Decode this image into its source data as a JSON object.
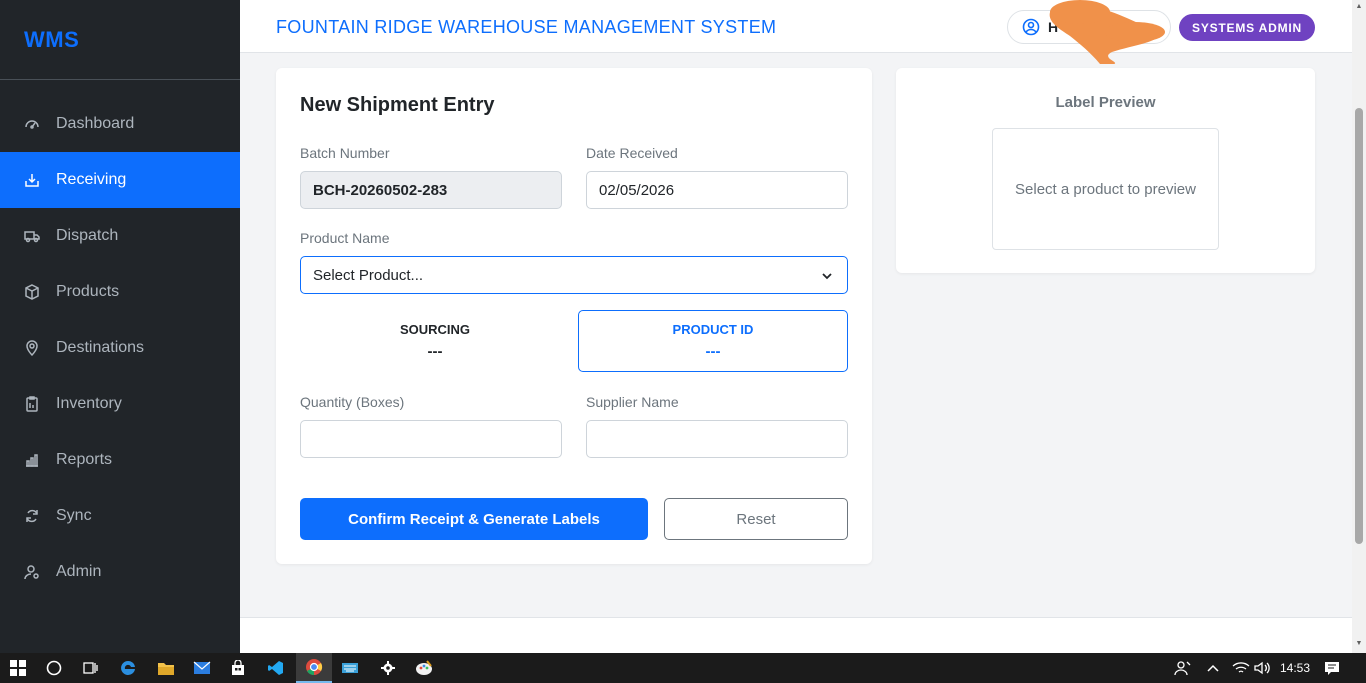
{
  "sidebar": {
    "brand": "WMS",
    "items": [
      {
        "label": "Dashboard",
        "icon": "gauge-icon"
      },
      {
        "label": "Receiving",
        "icon": "inbox-download-icon"
      },
      {
        "label": "Dispatch",
        "icon": "truck-icon"
      },
      {
        "label": "Products",
        "icon": "box-icon"
      },
      {
        "label": "Destinations",
        "icon": "map-pin-icon"
      },
      {
        "label": "Inventory",
        "icon": "clipboard-icon"
      },
      {
        "label": "Reports",
        "icon": "bar-chart-icon"
      },
      {
        "label": "Sync",
        "icon": "sync-icon"
      },
      {
        "label": "Admin",
        "icon": "user-gear-icon"
      }
    ],
    "active_index": 1
  },
  "header": {
    "title": "FOUNTAIN RIDGE WAREHOUSE MANAGEMENT SYSTEM",
    "user_initial": "H",
    "role_badge": "SYSTEMS ADMIN"
  },
  "form": {
    "title": "New Shipment Entry",
    "batch_label": "Batch Number",
    "batch_value": "BCH-20260502-283",
    "date_label": "Date Received",
    "date_value": "02/05/2026",
    "product_label": "Product Name",
    "product_value": "Select Product...",
    "sourcing_title": "SOURCING",
    "sourcing_value": "---",
    "product_id_title": "PRODUCT ID",
    "product_id_value": "---",
    "quantity_label": "Quantity (Boxes)",
    "quantity_value": "",
    "supplier_label": "Supplier Name",
    "supplier_value": "",
    "confirm_label": "Confirm Receipt & Generate Labels",
    "reset_label": "Reset"
  },
  "preview": {
    "title": "Label Preview",
    "placeholder": "Select a product to preview"
  },
  "taskbar": {
    "time": "14:53"
  },
  "colors": {
    "primary": "#0d6efd",
    "sidebar_bg": "#212529",
    "role_badge": "#6f42c1",
    "redaction": "#f0914a"
  }
}
